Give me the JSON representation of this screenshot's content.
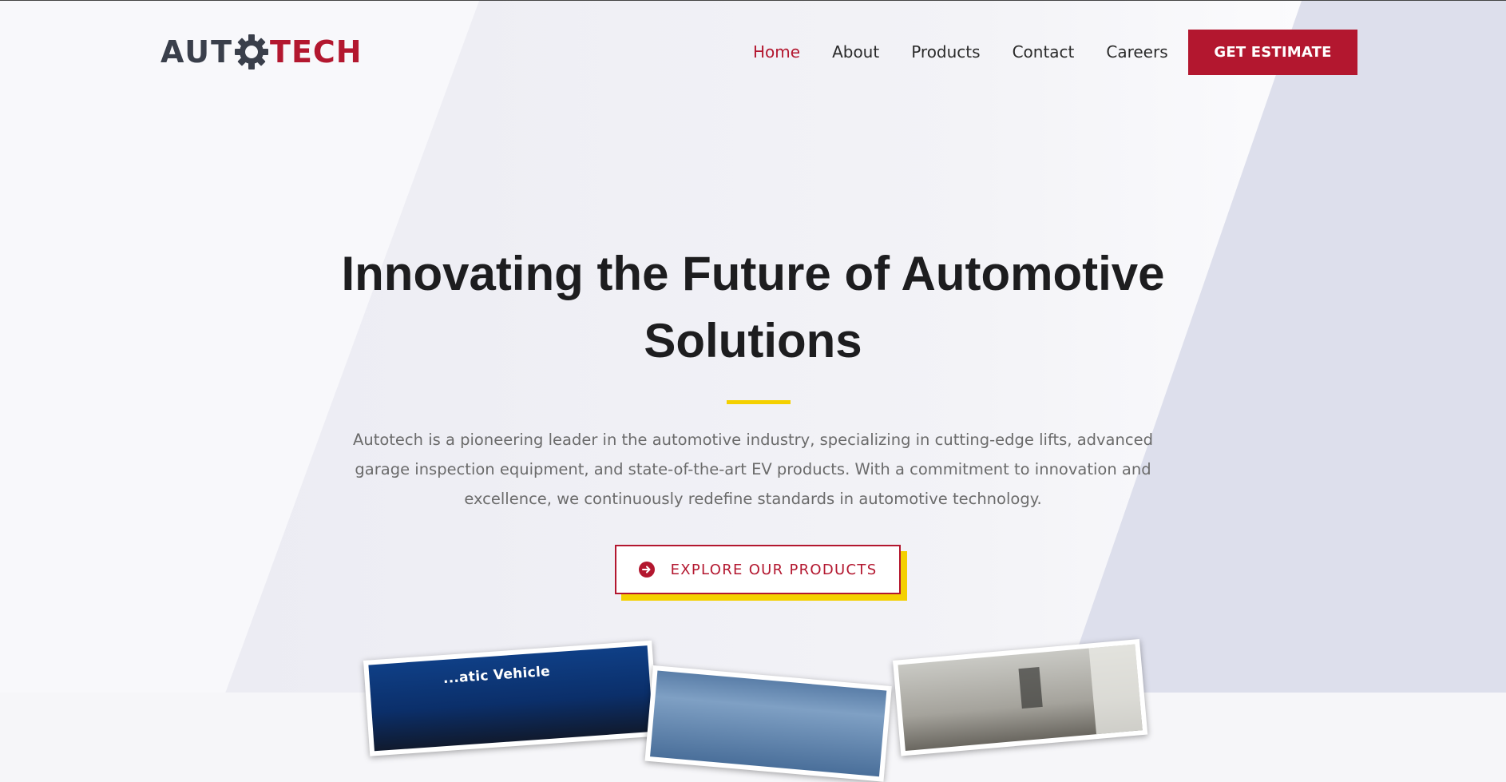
{
  "brand": {
    "logo_left": "AUT",
    "logo_right": "TECH",
    "primary_color": "#b3172f",
    "accent_color": "#f4d000",
    "dark_color": "#3a3f4b"
  },
  "nav": {
    "items": [
      {
        "label": "Home",
        "active": true
      },
      {
        "label": "About",
        "active": false
      },
      {
        "label": "Products",
        "active": false
      },
      {
        "label": "Contact",
        "active": false
      },
      {
        "label": "Careers",
        "active": false
      }
    ],
    "cta_label": "GET ESTIMATE"
  },
  "hero": {
    "title_line1": "Innovating the Future of Automotive",
    "title_line2": "Solutions",
    "description": "Autotech is a pioneering leader in the automotive industry, specializing in cutting-edge lifts, advanced garage inspection equipment, and state-of-the-art EV products. With a commitment to innovation and excellence, we continuously redefine standards in automotive technology.",
    "button_label": "EXPLORE OUR PRODUCTS",
    "button_icon": "arrow-right-circle-icon"
  },
  "gallery": {
    "cards": [
      {
        "caption": "...atic Vehicle"
      },
      {
        "caption": ""
      },
      {
        "caption": ""
      }
    ]
  }
}
